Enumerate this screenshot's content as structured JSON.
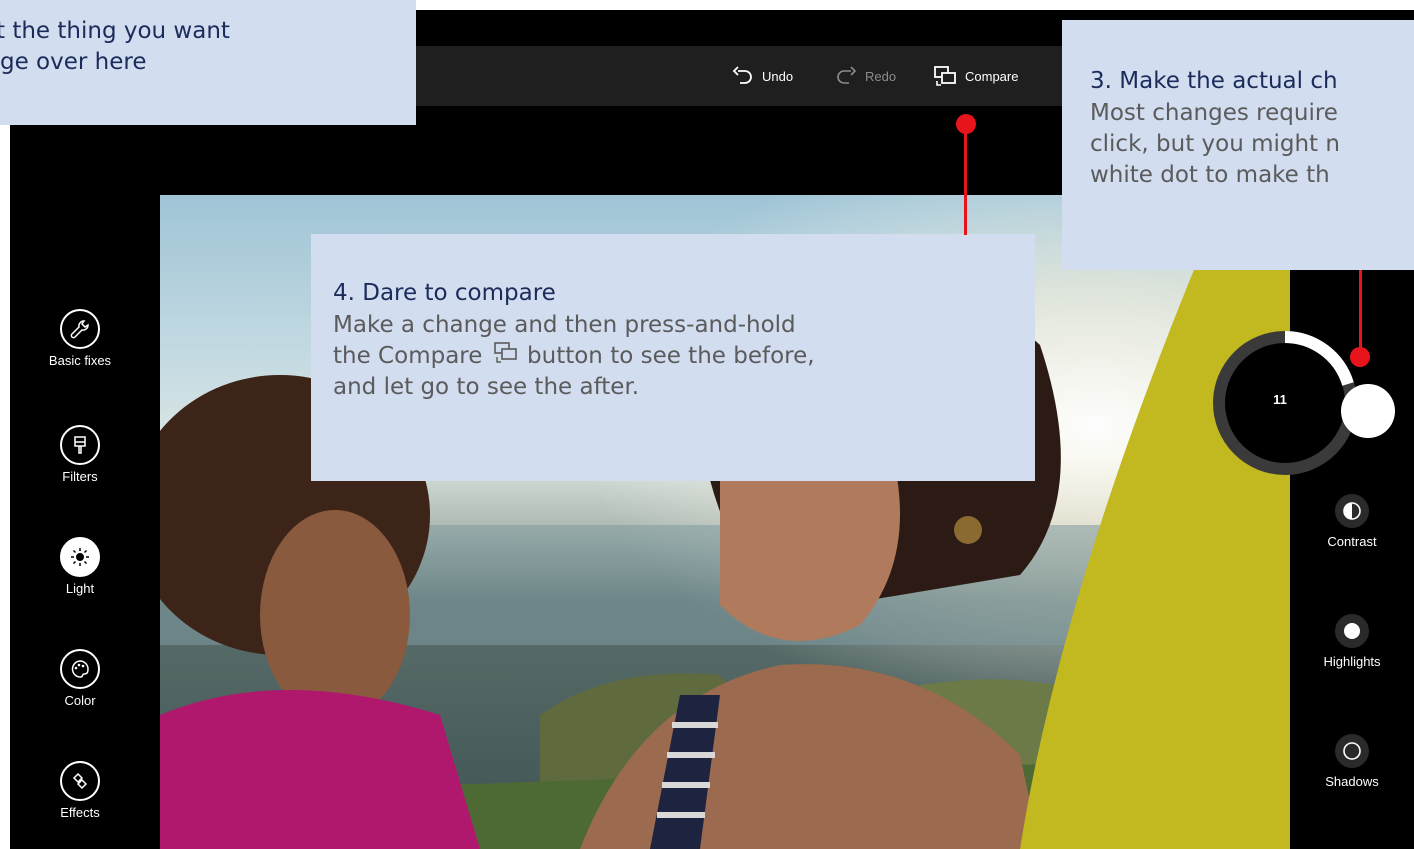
{
  "toolbar": {
    "undo_label": "Undo",
    "redo_label": "Redo",
    "compare_label": "Compare"
  },
  "left_tools": [
    {
      "label": "Basic fixes",
      "icon": "wrench-icon",
      "active": false
    },
    {
      "label": "Filters",
      "icon": "filter-icon",
      "active": false
    },
    {
      "label": "Light",
      "icon": "sun-icon",
      "active": true
    },
    {
      "label": "Color",
      "icon": "palette-icon",
      "active": false
    },
    {
      "label": "Effects",
      "icon": "effects-icon",
      "active": false
    }
  ],
  "right_adjustments": [
    {
      "label": "Contrast",
      "icon": "contrast-icon"
    },
    {
      "label": "Highlights",
      "icon": "highlights-icon"
    },
    {
      "label": "Shadows",
      "icon": "shadows-icon"
    }
  ],
  "dial": {
    "value": "11"
  },
  "callouts": {
    "select": {
      "line1": "t the thing you want",
      "line2": "ge over here"
    },
    "change": {
      "title": "3. Make the actual ch",
      "line1": "Most changes require",
      "line2": "click, but you might n",
      "line3": "white dot  to make th"
    },
    "compare": {
      "title": "4. Dare to compare",
      "line1": "Make a change and then press-and-hold",
      "line2_before": "the Compare",
      "line2_after": "button to see the before,",
      "line3": "and let go to see the after."
    }
  },
  "colors": {
    "callout_bg": "#d2ddf0",
    "pin_red": "#e8141c",
    "title_navy": "#1b2c5a",
    "toolbar_bg": "#1f1f1f"
  }
}
